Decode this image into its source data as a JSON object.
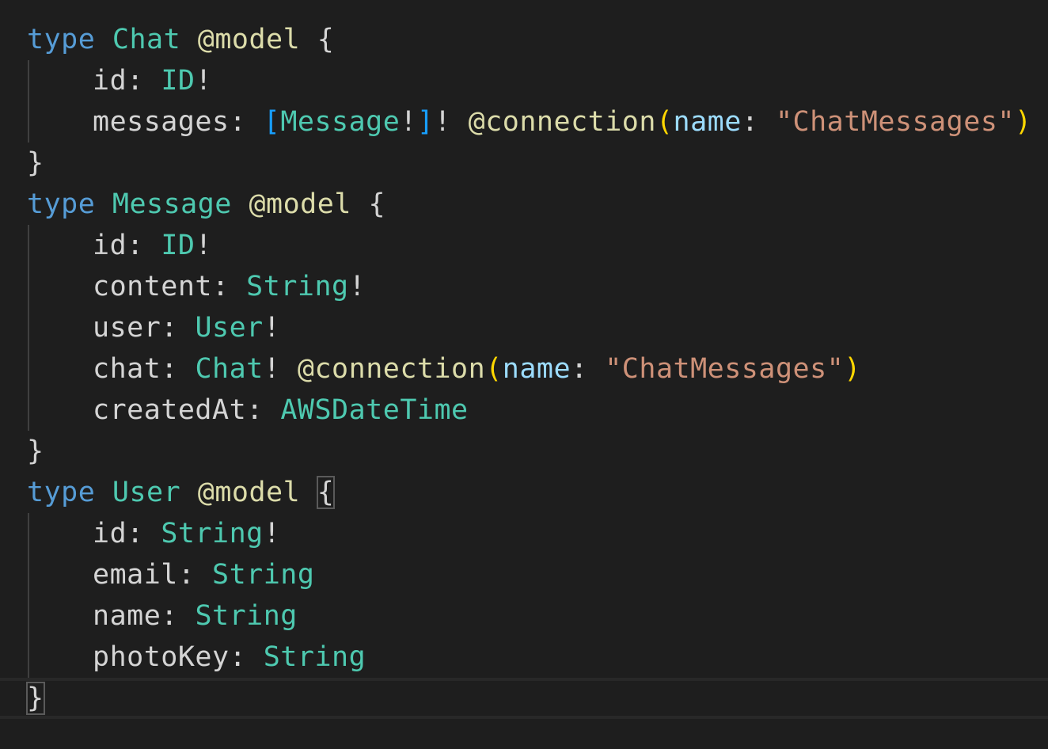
{
  "code": {
    "kw_type": "type",
    "directive_model": "@model",
    "directive_connection": "@connection",
    "open_brace": "{",
    "close_brace": "}",
    "colon": ":",
    "bang": "!",
    "chat_type": {
      "name": "Chat",
      "fields": [
        {
          "name": "id",
          "type": "ID"
        },
        {
          "name": "messages",
          "type": "Message",
          "arg_name": "name",
          "arg_value": "\"ChatMessages\""
        }
      ]
    },
    "message_type": {
      "name": "Message",
      "fields": [
        {
          "name": "id",
          "type": "ID"
        },
        {
          "name": "content",
          "type": "String"
        },
        {
          "name": "user",
          "type": "User"
        },
        {
          "name": "chat",
          "type": "Chat",
          "arg_name": "name",
          "arg_value": "\"ChatMessages\""
        },
        {
          "name": "createdAt",
          "type": "AWSDateTime"
        }
      ]
    },
    "user_type": {
      "name": "User",
      "fields": [
        {
          "name": "id",
          "type": "String"
        },
        {
          "name": "email",
          "type": "String"
        },
        {
          "name": "name",
          "type": "String"
        },
        {
          "name": "photoKey",
          "type": "String"
        }
      ]
    }
  },
  "colors": {
    "background": "#1e1e1e",
    "keyword": "#569cd6",
    "type": "#4ec9b0",
    "directive": "#dcdcaa",
    "string": "#ce9178",
    "argument": "#9cdcfe",
    "paren": "#ffd700",
    "bracket": "#179fff"
  }
}
